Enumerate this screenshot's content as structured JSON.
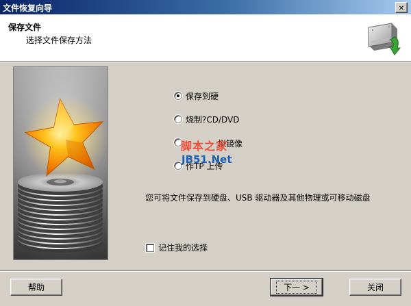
{
  "window": {
    "title": "文件恢复向导",
    "close_icon": "close-icon"
  },
  "header": {
    "title": "保存文件",
    "subtitle": "选择文件保存方法",
    "icon": "disk-restore-icon"
  },
  "illustration": {
    "icon": "star-on-disk-stack-image"
  },
  "options": [
    {
      "label": "保存到硬",
      "selected": true
    },
    {
      "label": "烧制?CD/DVD",
      "selected": false
    },
    {
      "label": "拟镜像",
      "selected": false
    },
    {
      "label": "作TP 上传",
      "selected": false
    }
  ],
  "description": "您可将文件保存到硬盘、USB 驱动器及其他物理或可移动磁盘",
  "remember": {
    "label": "记住我的选择",
    "checked": false
  },
  "buttons": {
    "help": "帮助",
    "next": "下一 >",
    "close": "关闭"
  },
  "watermark": {
    "text1": "脚本之家",
    "text2": "JB51.Net",
    "color1": "#f0503a",
    "color2": "#1a5fb4"
  },
  "colors": {
    "titlebar_start": "#0a246a",
    "titlebar_end": "#a6caf0",
    "dialog_bg": "#d4d0c8"
  }
}
